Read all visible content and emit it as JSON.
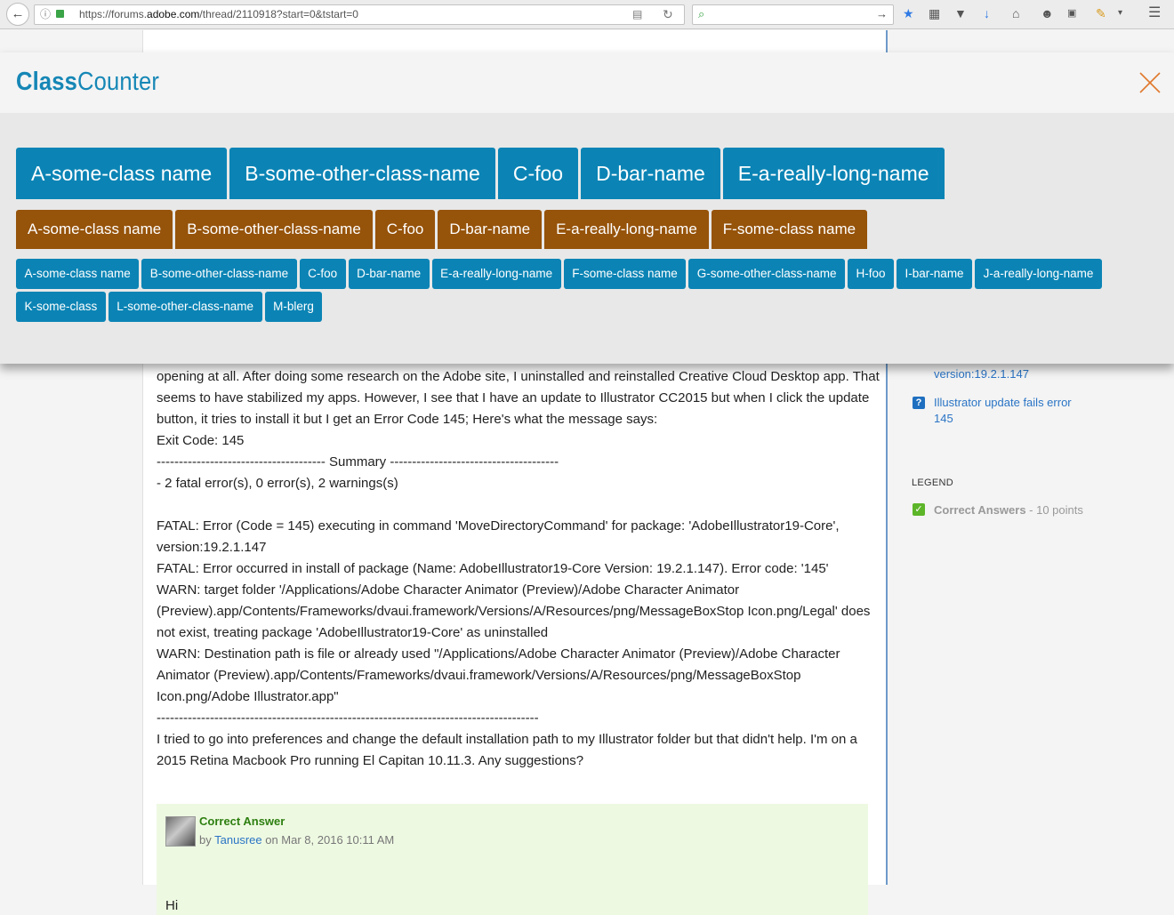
{
  "browser": {
    "url_prefix": "https://forums.",
    "url_domain": "adobe.com",
    "url_path": "/thread/2110918?start=0&tstart=0",
    "back_icon": "arrow-left-icon",
    "search_placeholder": ""
  },
  "overlay": {
    "brand_bold": "Class",
    "brand_rest": "Counter",
    "close_icon": "close-x-icon",
    "colors": {
      "blue": "#0b84b5",
      "brown": "#96530a",
      "brand": "#1687b6",
      "close": "#e0782c"
    },
    "large_tags": [
      "A-some-class name",
      "B-some-other-class-name",
      "C-foo",
      "D-bar-name",
      "E-a-really-long-name"
    ],
    "medium_tags": [
      "A-some-class name",
      "B-some-other-class-name",
      "C-foo",
      "D-bar-name",
      "E-a-really-long-name",
      "F-some-class name"
    ],
    "small_tags_row1": [
      "A-some-class name",
      "B-some-other-class-name",
      "C-foo",
      "D-bar-name",
      "E-a-really-long-name",
      "F-some-class name",
      "G-some-other-class-name",
      "H-foo",
      "I-bar-name",
      "J-a-really-long-name"
    ],
    "small_tags_row2": [
      "K-some-class",
      "L-some-other-class-name",
      "M-blerg"
    ]
  },
  "post": {
    "lines": [
      "opening at all. After doing some research on the Adobe site, I uninstalled and reinstalled Creative Cloud Desktop app. That",
      "seems to have stabilized my apps. However, I see that I have an update to Illustrator CC2015 but when I click the update",
      "button, it tries to install it but I get an Error Code 145; Here's what the message says:",
      "Exit Code: 145",
      "-------------------------------------- Summary --------------------------------------",
      "- 2 fatal error(s), 0 error(s), 2 warnings(s)",
      "",
      "FATAL: Error (Code = 145) executing in command 'MoveDirectoryCommand' for package: 'AdobeIllustrator19-Core',",
      "version:19.2.1.147",
      "FATAL: Error occurred in install of package (Name: AdobeIllustrator19-Core Version: 19.2.1.147). Error code: '145'",
      "WARN: target folder '/Applications/Adobe Character Animator (Preview)/Adobe Character Animator",
      "(Preview).app/Contents/Frameworks/dvaui.framework/Versions/A/Resources/png/MessageBoxStop Icon.png/Legal' does",
      "not exist, treating package 'AdobeIllustrator19-Core' as uninstalled",
      "WARN: Destination path is file or already used \"/Applications/Adobe Character Animator (Preview)/Adobe Character",
      "Animator (Preview).app/Contents/Frameworks/dvaui.framework/Versions/A/Resources/png/MessageBoxStop",
      "Icon.png/Adobe Illustrator.app\"",
      "--------------------------------------------------------------------------------------",
      "I tried to go into preferences and change the default installation path to my Illustrator folder but that didn't help. I'm on a",
      "2015 Retina Macbook Pro running El Capitan 10.11.3. Any suggestions?"
    ]
  },
  "answer": {
    "label": "Correct Answer",
    "by": "by",
    "author": "Tanusree",
    "on_date": "on Mar 8, 2016 10:11 AM",
    "first_line": "Hi"
  },
  "sidebar": {
    "partial_link": "version:19.2.1.147",
    "link_line1": "Illustrator update fails error",
    "link_line2": "145",
    "legend_title": "LEGEND",
    "legend_strong": "Correct Answers",
    "legend_rest": " - 10 points"
  }
}
